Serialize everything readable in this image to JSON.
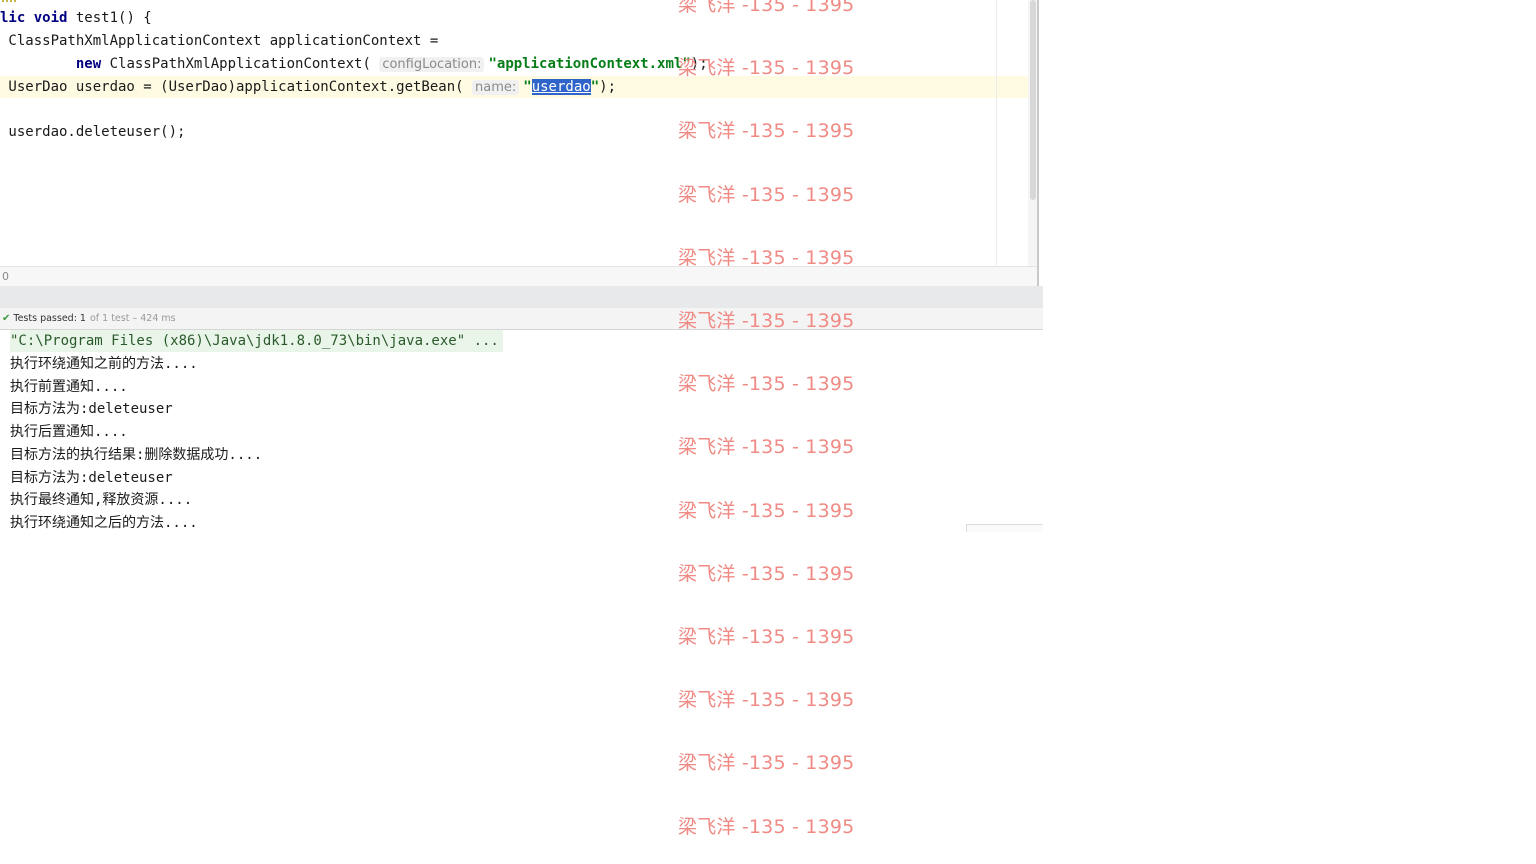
{
  "editor": {
    "lines": [
      {
        "segments": [
          {
            "t": "lic ",
            "c": "kw"
          },
          {
            "t": "void",
            "c": "kw"
          },
          {
            "t": " test1() {",
            "c": ""
          }
        ]
      },
      {
        "segments": [
          {
            "t": " ClassPathXmlApplicationContext applicationContext =",
            "c": ""
          }
        ]
      },
      {
        "segments": [
          {
            "t": "         ",
            "c": ""
          },
          {
            "t": "new",
            "c": "kw"
          },
          {
            "t": " ClassPathXmlApplicationContext( ",
            "c": ""
          },
          {
            "t": "configLocation:",
            "c": "hint"
          },
          {
            "t": "\"applicationContext.xml\"",
            "c": "str"
          },
          {
            "t": ");",
            "c": ""
          }
        ]
      },
      {
        "segments": [
          {
            "t": " UserDao userdao = (UserDao)applicationContext.getBean( ",
            "c": ""
          },
          {
            "t": "name:",
            "c": "hint"
          },
          {
            "t": "\"",
            "c": "str"
          },
          {
            "t": "userdao",
            "c": "sel"
          },
          {
            "t": "\"",
            "c": "str"
          },
          {
            "t": ");",
            "c": ""
          }
        ],
        "current": true
      },
      {
        "segments": [
          {
            "t": "",
            "c": ""
          }
        ]
      },
      {
        "segments": [
          {
            "t": " userdao.deleteuser();",
            "c": ""
          }
        ]
      }
    ],
    "gutter_number": "0"
  },
  "status": {
    "passed_label": "Tests passed: 1",
    "detail": "of 1 test – 424 ms"
  },
  "console": {
    "command": "\"C:\\Program Files (x86)\\Java\\jdk1.8.0_73\\bin\\java.exe\" ...",
    "lines": [
      "执行环绕通知之前的方法....",
      "执行前置通知....",
      "目标方法为:deleteuser",
      "执行后置通知....",
      "目标方法的执行结果:删除数据成功....",
      "目标方法为:deleteuser",
      "执行最终通知,释放资源....",
      "执行环绕通知之后的方法...."
    ]
  },
  "watermark": {
    "text": "梁飞洋 -135 - 1395",
    "color": "#f08a84",
    "count": 14
  },
  "icons": {
    "status_icon": "check-icon"
  }
}
